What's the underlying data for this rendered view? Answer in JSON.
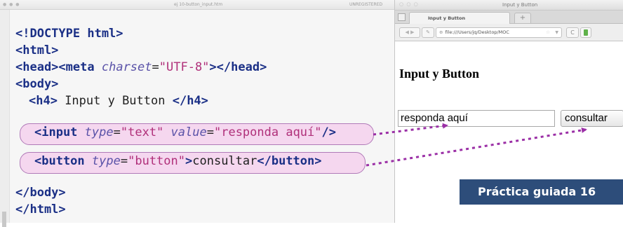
{
  "editor": {
    "file_name": "ej 10-button_input.htm",
    "status": "UNREGISTERED",
    "lines": {
      "doctype": "<!DOCTYPE html>",
      "html_open": "<html>",
      "head_open": "<head>",
      "meta_open": "<meta",
      "charset_attr": "charset",
      "charset_eq": "=",
      "charset_val": "\"UTF-8\"",
      "meta_close": ">",
      "head_close": "</head>",
      "body_open": "<body>",
      "h4_open": "<h4>",
      "h4_text": " Input y Button ",
      "h4_close": "</h4>",
      "input_open": "<input",
      "type_attr": "type",
      "eq": "=",
      "text_val": "\"text\"",
      "value_attr": "value",
      "value_val": "\"responda aquí\"",
      "input_close": "/>",
      "button_open": "<button",
      "button_type_val": "\"button\"",
      "button_gt": ">",
      "button_text": "consultar",
      "button_close": "</button>",
      "body_close": "</body>",
      "html_close": "</html>"
    }
  },
  "browser": {
    "window_title": "Input y Button",
    "tab_title": "Input y Button",
    "new_tab": "+",
    "url": "file:///Users/jq/Desktop/MOC",
    "page": {
      "heading": "Input y Button",
      "input_value": "responda aquí",
      "button_label": "consultar"
    }
  },
  "badge": {
    "label": "Práctica guiada  16"
  },
  "colors": {
    "tag": "#1a2f86",
    "attribute": "#5a52a8",
    "string": "#b0307a",
    "highlight_fill": "#f5d7ef",
    "arrow": "#9b2fa6",
    "badge_bg": "#2d4d7a"
  }
}
